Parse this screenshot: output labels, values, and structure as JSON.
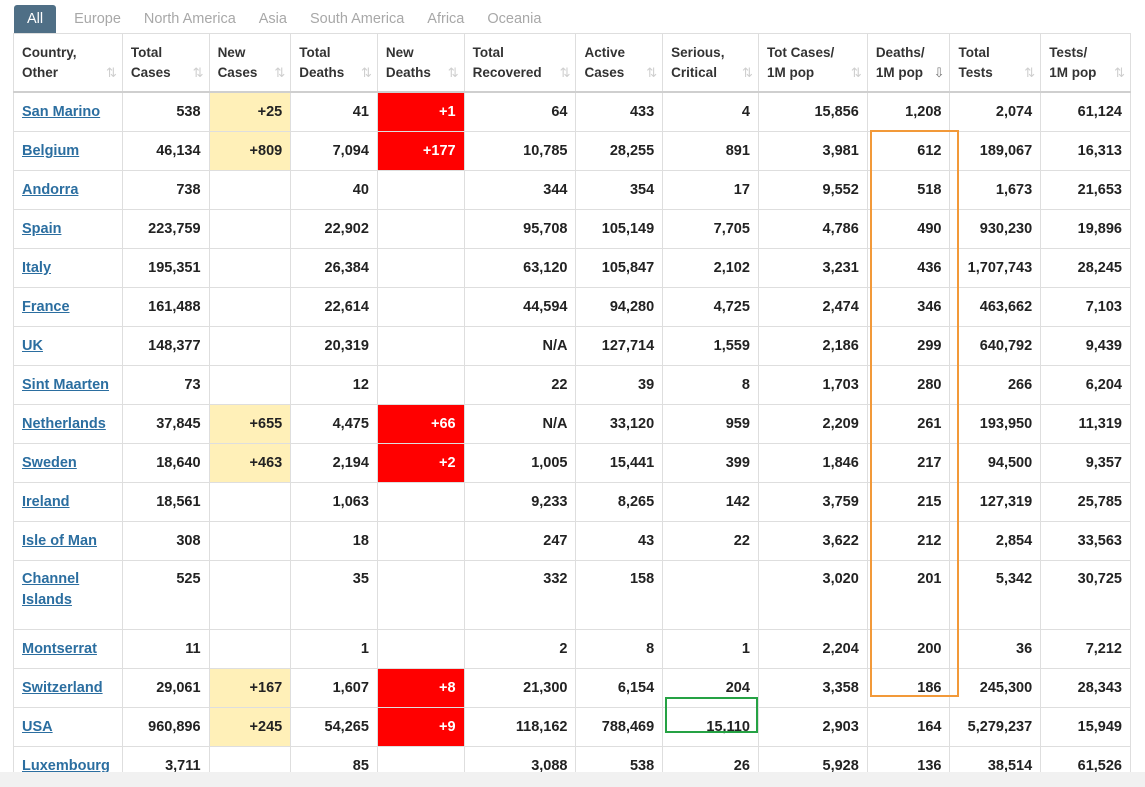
{
  "tabs": [
    "All",
    "Europe",
    "North America",
    "Asia",
    "South America",
    "Africa",
    "Oceania"
  ],
  "active_tab": "All",
  "headers": [
    {
      "l1": "Country,",
      "l2": "Other"
    },
    {
      "l1": "Total",
      "l2": "Cases"
    },
    {
      "l1": "New",
      "l2": "Cases"
    },
    {
      "l1": "Total",
      "l2": "Deaths"
    },
    {
      "l1": "New",
      "l2": "Deaths"
    },
    {
      "l1": "Total",
      "l2": "Recovered"
    },
    {
      "l1": "Active",
      "l2": "Cases"
    },
    {
      "l1": "Serious,",
      "l2": "Critical"
    },
    {
      "l1": "Tot Cases/",
      "l2": "1M pop"
    },
    {
      "l1": "Deaths/",
      "l2": "1M pop"
    },
    {
      "l1": "Total",
      "l2": "Tests"
    },
    {
      "l1": "Tests/",
      "l2": "1M pop"
    }
  ],
  "sort_icon": "⇅",
  "sort_icon_active": "⇩",
  "sorted_column": 9,
  "colors": {
    "tab_active": "#4f6f86",
    "new_cases_highlight": "#fff0b8",
    "new_deaths_highlight": "#ff0000",
    "link": "#2b6ea0",
    "orange_outline": "#f29939",
    "green_outline": "#25a244"
  },
  "rows": [
    [
      "San Marino",
      "538",
      "+25",
      "41",
      "+1",
      "64",
      "433",
      "4",
      "15,856",
      "1,208",
      "2,074",
      "61,124"
    ],
    [
      "Belgium",
      "46,134",
      "+809",
      "7,094",
      "+177",
      "10,785",
      "28,255",
      "891",
      "3,981",
      "612",
      "189,067",
      "16,313"
    ],
    [
      "Andorra",
      "738",
      "",
      "40",
      "",
      "344",
      "354",
      "17",
      "9,552",
      "518",
      "1,673",
      "21,653"
    ],
    [
      "Spain",
      "223,759",
      "",
      "22,902",
      "",
      "95,708",
      "105,149",
      "7,705",
      "4,786",
      "490",
      "930,230",
      "19,896"
    ],
    [
      "Italy",
      "195,351",
      "",
      "26,384",
      "",
      "63,120",
      "105,847",
      "2,102",
      "3,231",
      "436",
      "1,707,743",
      "28,245"
    ],
    [
      "France",
      "161,488",
      "",
      "22,614",
      "",
      "44,594",
      "94,280",
      "4,725",
      "2,474",
      "346",
      "463,662",
      "7,103"
    ],
    [
      "UK",
      "148,377",
      "",
      "20,319",
      "",
      "N/A",
      "127,714",
      "1,559",
      "2,186",
      "299",
      "640,792",
      "9,439"
    ],
    [
      "Sint Maarten",
      "73",
      "",
      "12",
      "",
      "22",
      "39",
      "8",
      "1,703",
      "280",
      "266",
      "6,204"
    ],
    [
      "Netherlands",
      "37,845",
      "+655",
      "4,475",
      "+66",
      "N/A",
      "33,120",
      "959",
      "2,209",
      "261",
      "193,950",
      "11,319"
    ],
    [
      "Sweden",
      "18,640",
      "+463",
      "2,194",
      "+2",
      "1,005",
      "15,441",
      "399",
      "1,846",
      "217",
      "94,500",
      "9,357"
    ],
    [
      "Ireland",
      "18,561",
      "",
      "1,063",
      "",
      "9,233",
      "8,265",
      "142",
      "3,759",
      "215",
      "127,319",
      "25,785"
    ],
    [
      "Isle of Man",
      "308",
      "",
      "18",
      "",
      "247",
      "43",
      "22",
      "3,622",
      "212",
      "2,854",
      "33,563"
    ],
    [
      "Channel Islands",
      "525",
      "",
      "35",
      "",
      "332",
      "158",
      "",
      "3,020",
      "201",
      "5,342",
      "30,725"
    ],
    [
      "Montserrat",
      "11",
      "",
      "1",
      "",
      "2",
      "8",
      "1",
      "2,204",
      "200",
      "36",
      "7,212"
    ],
    [
      "Switzerland",
      "29,061",
      "+167",
      "1,607",
      "+8",
      "21,300",
      "6,154",
      "204",
      "3,358",
      "186",
      "245,300",
      "28,343"
    ],
    [
      "USA",
      "960,896",
      "+245",
      "54,265",
      "+9",
      "118,162",
      "788,469",
      "15,110",
      "2,903",
      "164",
      "5,279,237",
      "15,949"
    ],
    [
      "Luxembourg",
      "3,711",
      "",
      "85",
      "",
      "3,088",
      "538",
      "26",
      "5,928",
      "136",
      "38,514",
      "61,526"
    ]
  ]
}
